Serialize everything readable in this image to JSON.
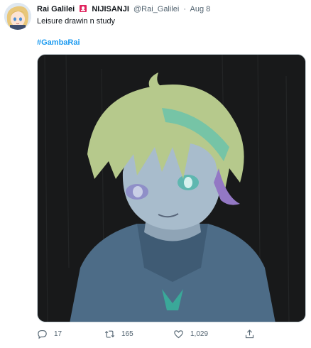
{
  "tweet": {
    "display_name": "Rai Galilei",
    "org_name": "NIJISANJI",
    "handle": "@Rai_Galilei",
    "separator": "·",
    "date": "Aug 8",
    "text": "Leisure drawin n study",
    "hashtag": "#GambaRai"
  },
  "actions": {
    "reply_count": "17",
    "retweet_count": "165",
    "like_count": "1,029"
  },
  "icons": {
    "avatar": "anime-avatar",
    "flag": "siren-emoji-icon",
    "reply": "reply-icon",
    "retweet": "retweet-icon",
    "like": "heart-icon",
    "share": "share-icon"
  },
  "colors": {
    "accent": "#1d9bf0",
    "muted": "#536471",
    "text": "#0f1419",
    "media_bg": "#17191a"
  }
}
